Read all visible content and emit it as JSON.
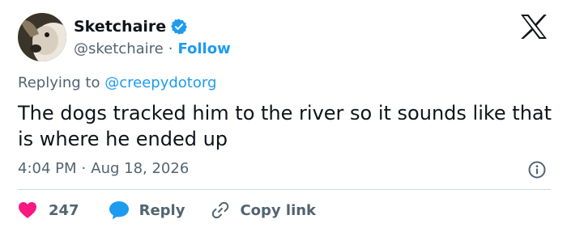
{
  "author": {
    "display_name": "Sketchaire",
    "handle": "@sketchaire",
    "separator": "·",
    "follow_label": "Follow"
  },
  "reply_context": {
    "prefix": "Replying to",
    "mention": "@creepydotorg"
  },
  "tweet": {
    "text": "The dogs tracked him to the river so it sounds like that is where he ended up",
    "time": "4:04 PM",
    "separator": "·",
    "date": "Aug 18, 2026"
  },
  "actions": {
    "like_count": "247",
    "reply_label": "Reply",
    "copy_link_label": "Copy link"
  },
  "colors": {
    "accent": "#1d9bf0",
    "like": "#f91880",
    "text": "#0f1419",
    "muted": "#536471",
    "divider": "#cfd9de"
  },
  "icons": {
    "verified": "verified-badge-icon",
    "brand": "x-logo-icon",
    "info": "info-icon",
    "like": "heart-icon",
    "reply": "speech-bubble-icon",
    "copy_link": "link-icon"
  }
}
